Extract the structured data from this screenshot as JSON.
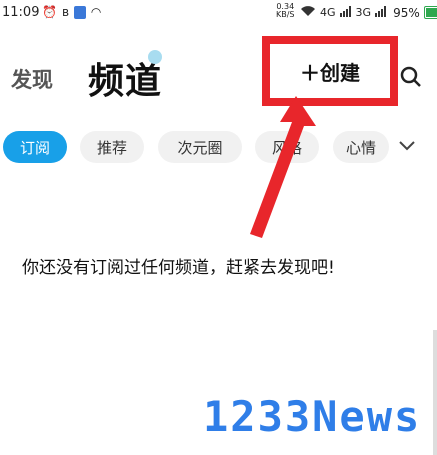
{
  "status_bar": {
    "time": "11:09",
    "net_speed_value": "0.34",
    "net_speed_unit": "KB/S",
    "signal_1": "4G",
    "signal_2": "3G",
    "battery": "95%",
    "battery_level": 0.95,
    "battery_color": "#2fa84f"
  },
  "header": {
    "tab_discover": "发现",
    "tab_channel": "频道",
    "create_label": "＋创建"
  },
  "tabs": [
    {
      "label": "订阅",
      "active": true
    },
    {
      "label": "推荐",
      "active": false
    },
    {
      "label": "次元圈",
      "active": false
    },
    {
      "label": "风格",
      "active": false
    },
    {
      "label": "心情",
      "active": false
    }
  ],
  "main": {
    "empty_message": "你还没有订阅过任何频道，赶紧去发现吧!"
  },
  "watermark": "1233News",
  "colors": {
    "accent": "#18a0e8",
    "highlight_red": "#e8262b"
  }
}
